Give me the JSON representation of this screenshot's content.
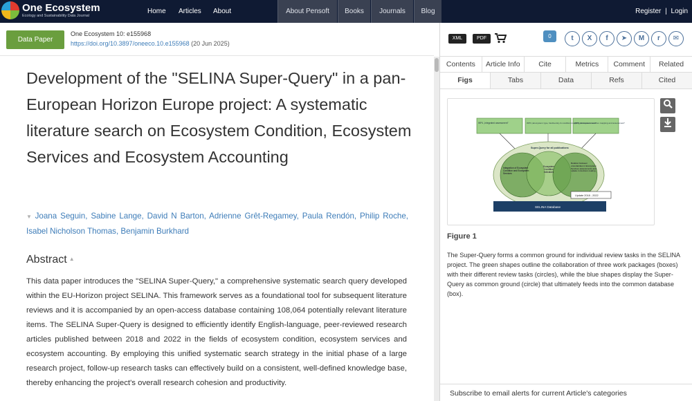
{
  "nav": {
    "logo_title": "One Ecosystem",
    "logo_subtitle": "Ecology and Sustainability Data Journal",
    "links": [
      "Home",
      "Articles",
      "About"
    ],
    "blocks": [
      "About Pensoft",
      "Books",
      "Journals",
      "Blog"
    ],
    "register": "Register",
    "separator": "|",
    "login": "Login"
  },
  "article_bar": {
    "type_label": "Data Paper",
    "citation": "One Ecosystem 10: e155968",
    "doi": "https://doi.org/10.3897/oneeco.10.e155968",
    "date": " (20 Jun 2025)"
  },
  "article": {
    "title": "Development of the \"SELINA Super-Query\" in a pan-European Horizon Europe project: A systematic literature search on Ecosystem Condition, Ecosystem Services and Ecosystem Accounting",
    "authors_caret": "▼",
    "authors": "Joana Seguin, Sabine Lange, David N Barton, Adrienne Grêt-Regamey, Paula Rendón, Philip Roche, Isabel Nicholson Thomas, Benjamin Burkhard",
    "abstract_heading": "Abstract",
    "abstract_caret": "▲",
    "abstract_text": "This data paper introduces the \"SELINA Super-Query,\" a comprehensive systematic search query developed within the EU-Horizon project SELINA. This framework serves as a foundational tool for subsequent literature reviews and it is accompanied by an open-access database containing 108,064 potentially relevant literature items. The SELINA Super-Query is designed to efficiently identify English-language, peer-reviewed research articles published between 2018 and 2022 in the fields of ecosystem condition, ecosystem services and ecosystem accounting. By employing this unified systematic search strategy in the initial phase of a large research project, follow-up research tasks can effectively build on a consistent, well-defined knowledge base, thereby enhancing the project's overall research cohesion and productivity."
  },
  "right_panel": {
    "xml_label": "XML",
    "pdf_label": "PDF",
    "cart_icon": "cart-icon",
    "comment_count": "0",
    "share_icons": [
      "twitter-icon",
      "x-icon",
      "facebook-icon",
      "telegram-icon",
      "mendeley-icon",
      "reddit-icon",
      "email-icon"
    ],
    "tabs_row1": [
      "Contents",
      "Article Info",
      "Cite",
      "Metrics",
      "Comment",
      "Related"
    ],
    "tabs_row2": [
      "Figs",
      "Tabs",
      "Data",
      "Refs",
      "Cited"
    ],
    "active_tab": "Figs",
    "figure": {
      "label": "Figure 1",
      "caption": "The Super-Query forms a common ground for individual review tasks in the SELINA project. The green shapes outline the collaboration of three work packages (boxes) with their different review tasks (circles), while the blue shapes display the Super-Query as common ground (circle) that ultimately feeds into the common database (box).",
      "diagram": {
        "wp_boxes": [
          "WP4 „Integrated assessment\"",
          "WP3 „Ecosystem type, biodiversity & condition mapping and assessment\"",
          "WP5 „Ecosystem services mapping and assessment\""
        ],
        "super_query": "Super-Query for all publications",
        "circle_left": "Integration of Ecosystem Condition and Ecosystem Services",
        "circle_middle": "Ecosystem Condition indicators",
        "circle_right": "Relation between uncertainties in Ecosystem Services assessments and uptake in decision making",
        "update": "Update 2018 - 2022",
        "database": "SELINA Database"
      }
    },
    "subscribe": "Subscribe to email alerts for current Article's categories",
    "colors": {
      "nav_bg": "#0f1a33",
      "link": "#3d7cb8",
      "badge": "#6a9e3e"
    }
  }
}
